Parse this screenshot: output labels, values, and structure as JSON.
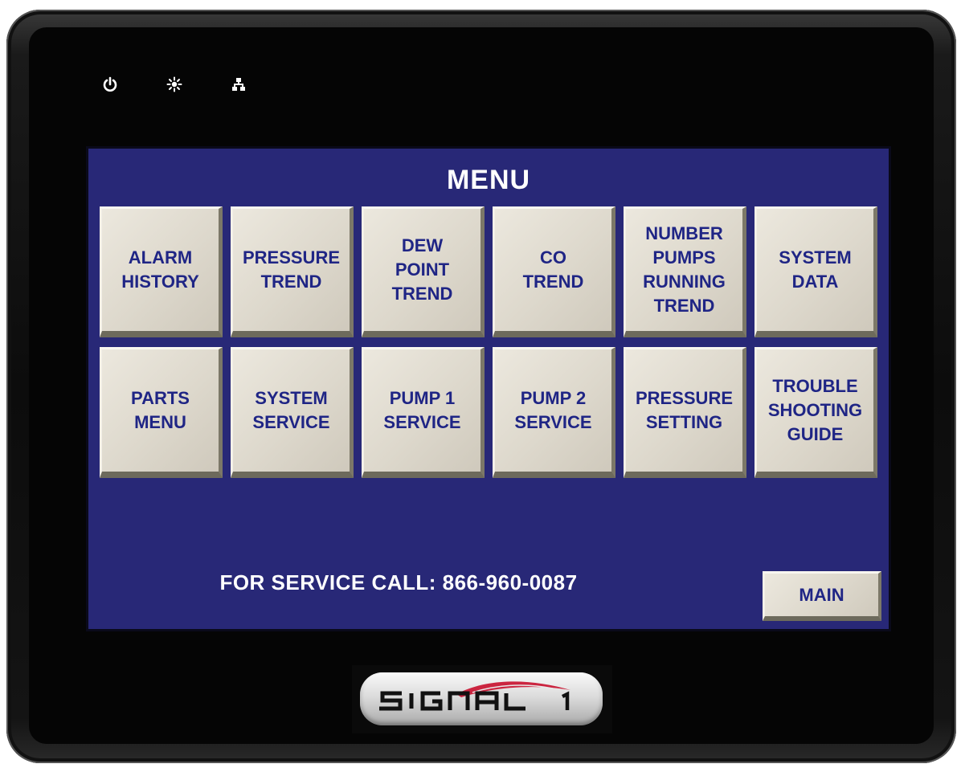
{
  "menu": {
    "title": "MENU",
    "buttons": [
      {
        "label": "ALARM\nHISTORY"
      },
      {
        "label": "PRESSURE\nTREND"
      },
      {
        "label": "DEW\nPOINT\nTREND"
      },
      {
        "label": "CO\nTREND"
      },
      {
        "label": "NUMBER\nPUMPS\nRUNNING\nTREND"
      },
      {
        "label": "SYSTEM\nDATA"
      },
      {
        "label": "PARTS\nMENU"
      },
      {
        "label": "SYSTEM\nSERVICE"
      },
      {
        "label": "PUMP 1\nSERVICE"
      },
      {
        "label": "PUMP 2\nSERVICE"
      },
      {
        "label": "PRESSURE\nSETTING"
      },
      {
        "label": "TROUBLE\nSHOOTING\nGUIDE"
      }
    ]
  },
  "footer": {
    "service_text": "FOR SERVICE CALL: 866-960-0087",
    "main_label": "MAIN"
  },
  "status_icons": [
    "power-icon",
    "brightness-icon",
    "network-icon"
  ],
  "logo": {
    "text": "SIGNAL 1"
  },
  "colors": {
    "screen_background": "#282877",
    "button_face": "#ddd8cc",
    "button_text": "#1f2585",
    "title_text": "#ffffff",
    "logo_swoosh": "#c8102e"
  }
}
